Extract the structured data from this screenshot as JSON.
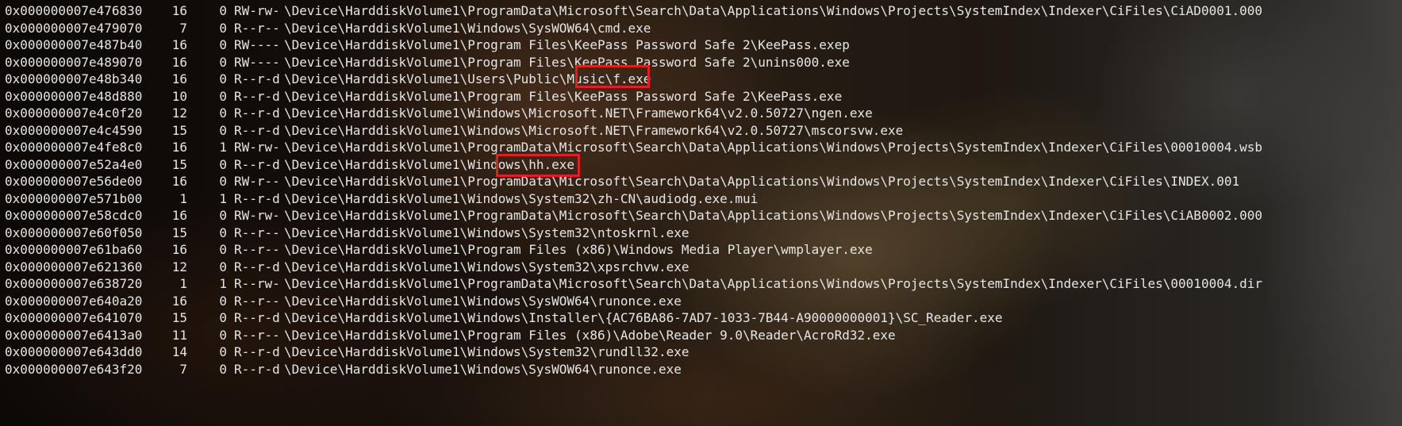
{
  "window": {
    "type": "terminal",
    "background": "tavern-scene-wallpaper",
    "text_color": "#e6e6e6",
    "highlight_color": "#e02020"
  },
  "rows": [
    {
      "addr": "0x000000007e476830",
      "c1": "16",
      "c2": "0",
      "attr": "RW-rw-",
      "path": "\\Device\\HarddiskVolume1\\ProgramData\\Microsoft\\Search\\Data\\Applications\\Windows\\Projects\\SystemIndex\\Indexer\\CiFiles\\CiAD0001.000"
    },
    {
      "addr": "0x000000007e479070",
      "c1": "7",
      "c2": "0",
      "attr": "R--r--",
      "path": "\\Device\\HarddiskVolume1\\Windows\\SysWOW64\\cmd.exe"
    },
    {
      "addr": "0x000000007e487b40",
      "c1": "16",
      "c2": "0",
      "attr": "RW----",
      "path": "\\Device\\HarddiskVolume1\\Program Files\\KeePass Password Safe 2\\KeePass.exep"
    },
    {
      "addr": "0x000000007e489070",
      "c1": "16",
      "c2": "0",
      "attr": "RW----",
      "path": "\\Device\\HarddiskVolume1\\Program Files\\KeePass Password Safe 2\\unins000.exe"
    },
    {
      "addr": "0x000000007e48b340",
      "c1": "16",
      "c2": "0",
      "attr": "R--r-d",
      "path": "\\Device\\HarddiskVolume1\\Users\\Public\\Music\\f.exe"
    },
    {
      "addr": "0x000000007e48d880",
      "c1": "10",
      "c2": "0",
      "attr": "R--r-d",
      "path": "\\Device\\HarddiskVolume1\\Program Files\\KeePass Password Safe 2\\KeePass.exe"
    },
    {
      "addr": "0x000000007e4c0f20",
      "c1": "12",
      "c2": "0",
      "attr": "R--r-d",
      "path": "\\Device\\HarddiskVolume1\\Windows\\Microsoft.NET\\Framework64\\v2.0.50727\\ngen.exe"
    },
    {
      "addr": "0x000000007e4c4590",
      "c1": "15",
      "c2": "0",
      "attr": "R--r-d",
      "path": "\\Device\\HarddiskVolume1\\Windows\\Microsoft.NET\\Framework64\\v2.0.50727\\mscorsvw.exe"
    },
    {
      "addr": "0x000000007e4fe8c0",
      "c1": "16",
      "c2": "1",
      "attr": "RW-rw-",
      "path": "\\Device\\HarddiskVolume1\\ProgramData\\Microsoft\\Search\\Data\\Applications\\Windows\\Projects\\SystemIndex\\Indexer\\CiFiles\\00010004.wsb"
    },
    {
      "addr": "0x000000007e52a4e0",
      "c1": "15",
      "c2": "0",
      "attr": "R--r-d",
      "path": "\\Device\\HarddiskVolume1\\Windows\\hh.exe"
    },
    {
      "addr": "0x000000007e56de00",
      "c1": "16",
      "c2": "0",
      "attr": "RW-r--",
      "path": "\\Device\\HarddiskVolume1\\ProgramData\\Microsoft\\Search\\Data\\Applications\\Windows\\Projects\\SystemIndex\\Indexer\\CiFiles\\INDEX.001"
    },
    {
      "addr": "0x000000007e571b00",
      "c1": "1",
      "c2": "1",
      "attr": "R--r-d",
      "path": "\\Device\\HarddiskVolume1\\Windows\\System32\\zh-CN\\audiodg.exe.mui"
    },
    {
      "addr": "0x000000007e58cdc0",
      "c1": "16",
      "c2": "0",
      "attr": "RW-rw-",
      "path": "\\Device\\HarddiskVolume1\\ProgramData\\Microsoft\\Search\\Data\\Applications\\Windows\\Projects\\SystemIndex\\Indexer\\CiFiles\\CiAB0002.000"
    },
    {
      "addr": "0x000000007e60f050",
      "c1": "15",
      "c2": "0",
      "attr": "R--r--",
      "path": "\\Device\\HarddiskVolume1\\Windows\\System32\\ntoskrnl.exe"
    },
    {
      "addr": "0x000000007e61ba60",
      "c1": "16",
      "c2": "0",
      "attr": "R--r--",
      "path": "\\Device\\HarddiskVolume1\\Program Files (x86)\\Windows Media Player\\wmplayer.exe"
    },
    {
      "addr": "0x000000007e621360",
      "c1": "12",
      "c2": "0",
      "attr": "R--r-d",
      "path": "\\Device\\HarddiskVolume1\\Windows\\System32\\xpsrchvw.exe"
    },
    {
      "addr": "0x000000007e638720",
      "c1": "1",
      "c2": "1",
      "attr": "R--rw-",
      "path": "\\Device\\HarddiskVolume1\\ProgramData\\Microsoft\\Search\\Data\\Applications\\Windows\\Projects\\SystemIndex\\Indexer\\CiFiles\\00010004.dir"
    },
    {
      "addr": "0x000000007e640a20",
      "c1": "16",
      "c2": "0",
      "attr": "R--r--",
      "path": "\\Device\\HarddiskVolume1\\Windows\\SysWOW64\\runonce.exe"
    },
    {
      "addr": "0x000000007e641070",
      "c1": "15",
      "c2": "0",
      "attr": "R--r-d",
      "path": "\\Device\\HarddiskVolume1\\Windows\\Installer\\{AC76BA86-7AD7-1033-7B44-A90000000001}\\SC_Reader.exe"
    },
    {
      "addr": "0x000000007e6413a0",
      "c1": "11",
      "c2": "0",
      "attr": "R--r--",
      "path": "\\Device\\HarddiskVolume1\\Program Files (x86)\\Adobe\\Reader 9.0\\Reader\\AcroRd32.exe"
    },
    {
      "addr": "0x000000007e643dd0",
      "c1": "14",
      "c2": "0",
      "attr": "R--r-d",
      "path": "\\Device\\HarddiskVolume1\\Windows\\System32\\rundll32.exe"
    },
    {
      "addr": "0x000000007e643f20",
      "c1": "7",
      "c2": "0",
      "attr": "R--r-d",
      "path": "\\Device\\HarddiskVolume1\\Windows\\SysWOW64\\runonce.exe"
    }
  ],
  "highlights": [
    {
      "text": "\\f.exe",
      "row": 4
    },
    {
      "text": "\\hh.exe",
      "row": 9
    }
  ]
}
